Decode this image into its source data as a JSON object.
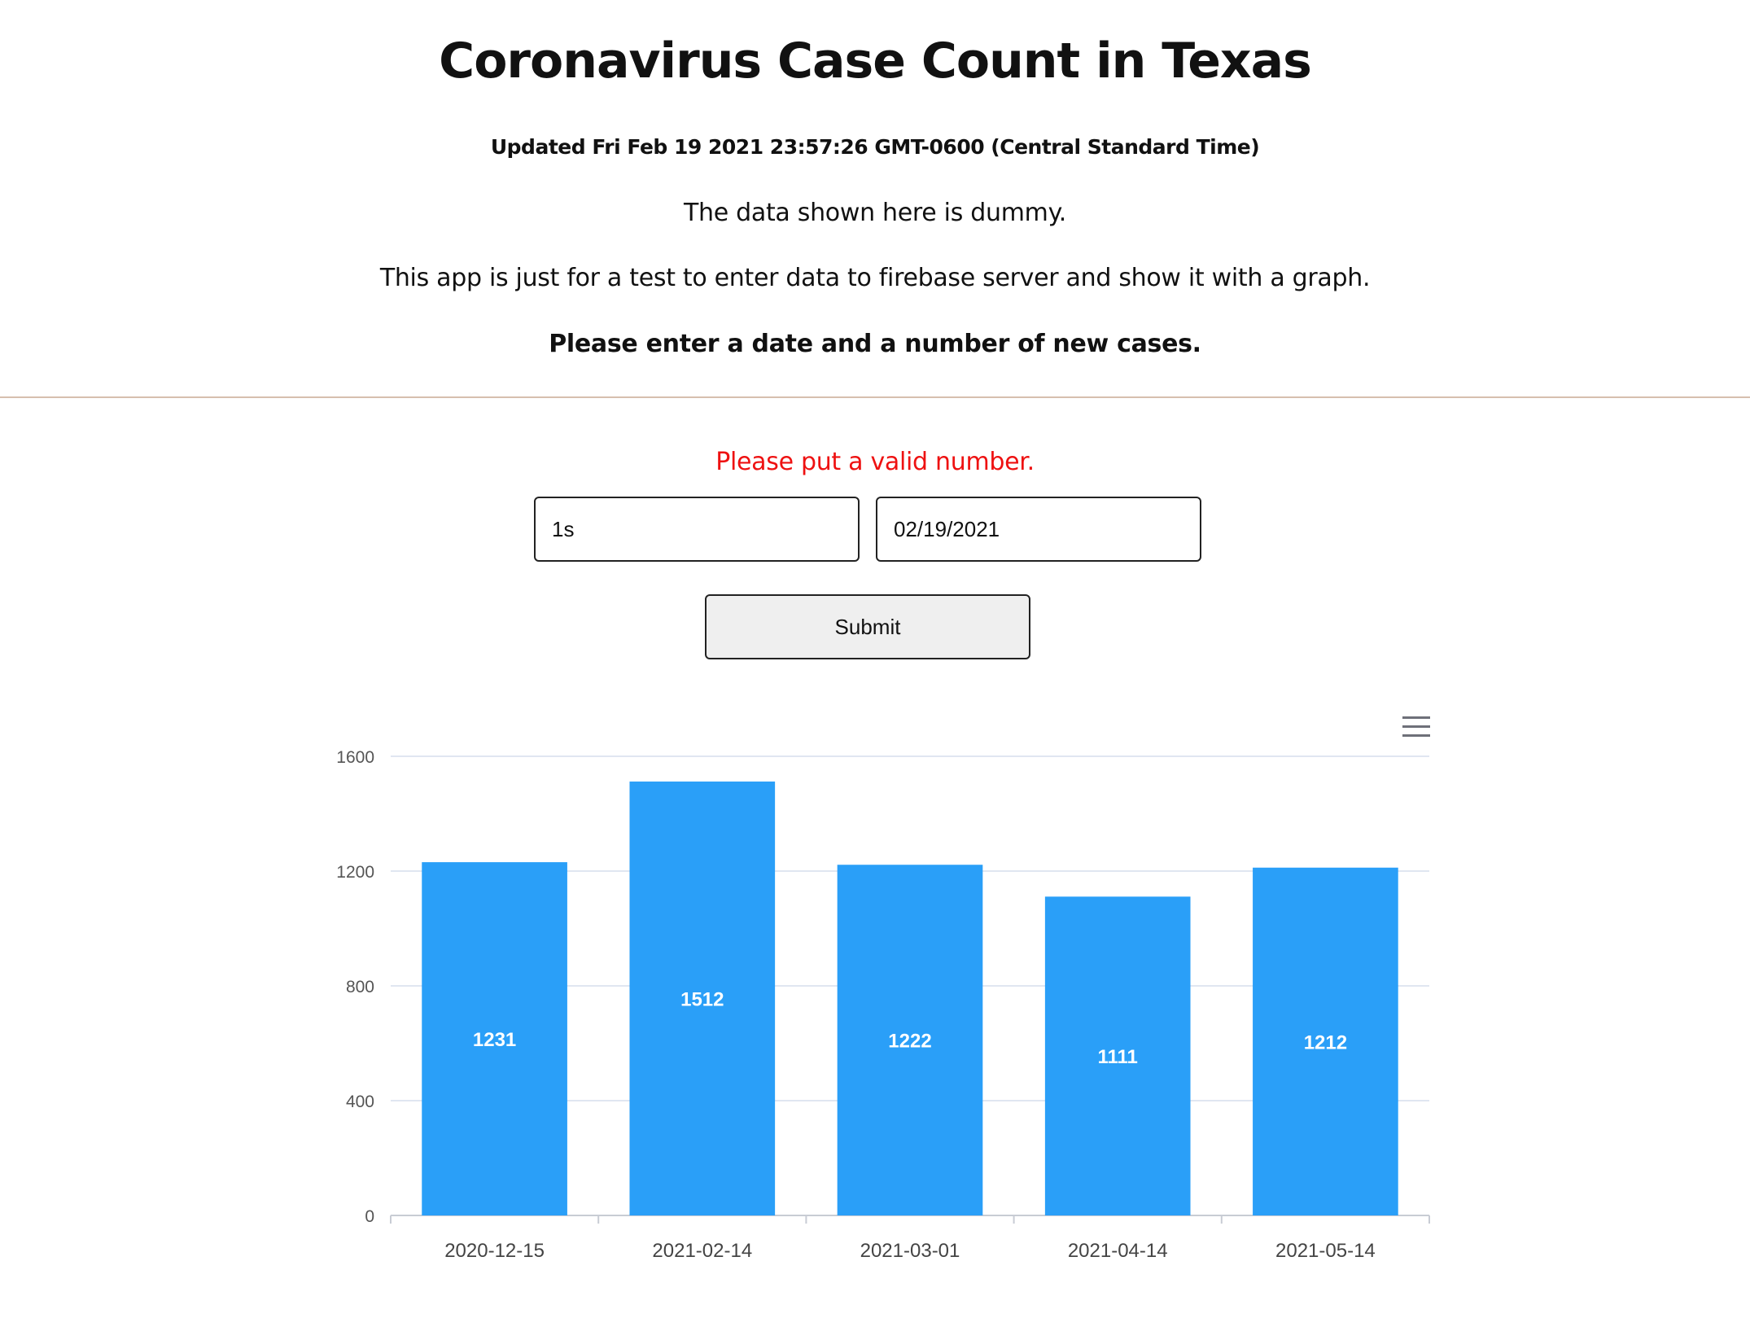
{
  "header": {
    "title": "Coronavirus Case Count in Texas",
    "updated": "Updated Fri Feb 19 2021 23:57:26 GMT-0600 (Central Standard Time)",
    "note": "The data shown here is dummy.",
    "description": "This app is just for a test to enter data to firebase server and show it with a graph.",
    "instruction": "Please enter a date and a number of new cases."
  },
  "form": {
    "error": "Please put a valid number.",
    "count_value": "1s",
    "date_value": "02/19/2021",
    "submit_label": "Submit"
  },
  "chart_data": {
    "type": "bar",
    "categories": [
      "2020-12-15",
      "2021-02-14",
      "2021-03-01",
      "2021-04-14",
      "2021-05-14"
    ],
    "values": [
      1231,
      1512,
      1222,
      1111,
      1212
    ],
    "yticks": [
      "0",
      "400",
      "800",
      "1200",
      "1600"
    ],
    "ylim": [
      0,
      1600
    ],
    "bar_color": "#2a9ff8",
    "label_color": "#ffffff",
    "grid": true,
    "title": "",
    "xlabel": "",
    "ylabel": ""
  },
  "toolbox": {
    "icon": "menu-icon"
  }
}
